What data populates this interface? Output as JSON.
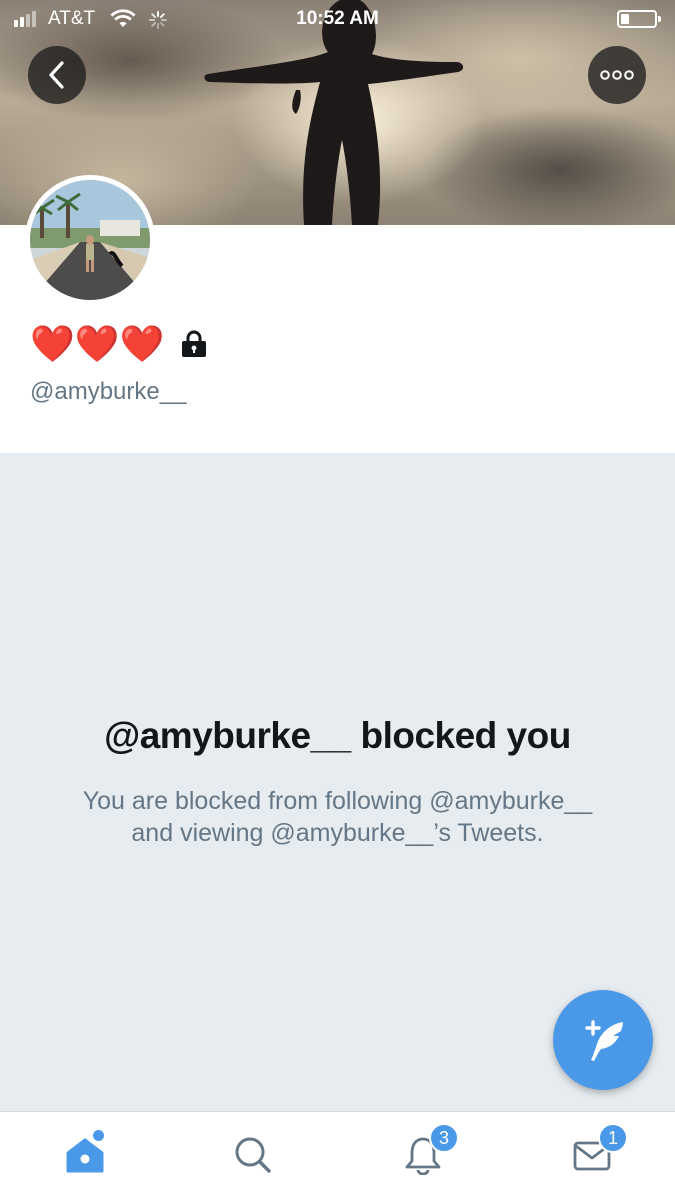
{
  "status_bar": {
    "carrier": "AT&T",
    "time": "10:52 AM",
    "battery_level": 0.25
  },
  "header": {
    "back_icon": "chevron-left-icon",
    "more_icon": "more-horizontal-icon"
  },
  "profile": {
    "display_name_emoji": "❤️❤️❤️",
    "protected_icon": "lock-icon",
    "handle": "@amyburke__"
  },
  "blocked": {
    "title": "@amyburke__ blocked you",
    "message": "You are blocked from following @amyburke__ and viewing @amyburke__’s Tweets."
  },
  "fab": {
    "icon": "compose-tweet-icon"
  },
  "tab_bar": {
    "tabs": [
      {
        "name": "home",
        "icon": "home-icon",
        "active": true,
        "has_dot": true
      },
      {
        "name": "search",
        "icon": "search-icon",
        "active": false
      },
      {
        "name": "notifications",
        "icon": "bell-icon",
        "badge": "3"
      },
      {
        "name": "messages",
        "icon": "mail-icon",
        "badge": "1"
      }
    ]
  },
  "colors": {
    "accent": "#4a99e9",
    "blocked_bg": "#e6ecf0",
    "secondary_text": "#657786",
    "primary_text": "#14171a"
  }
}
